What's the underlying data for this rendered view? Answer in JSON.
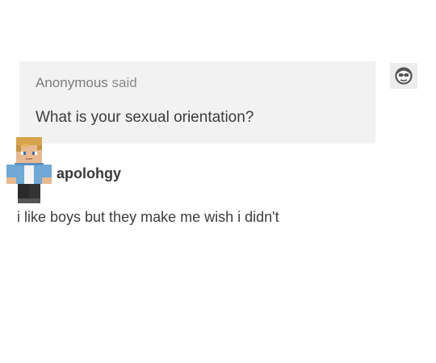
{
  "ask": {
    "asker_name": "Anonymous",
    "asker_verb": "said",
    "question": "What is your sexual orientation?",
    "anon_icon": "anonymous-face-with-glasses-icon"
  },
  "answer": {
    "avatar_icon": "minecraft-skin-avatar",
    "username": "apolohgy",
    "text": "i like boys but they make me wish i didn't"
  }
}
